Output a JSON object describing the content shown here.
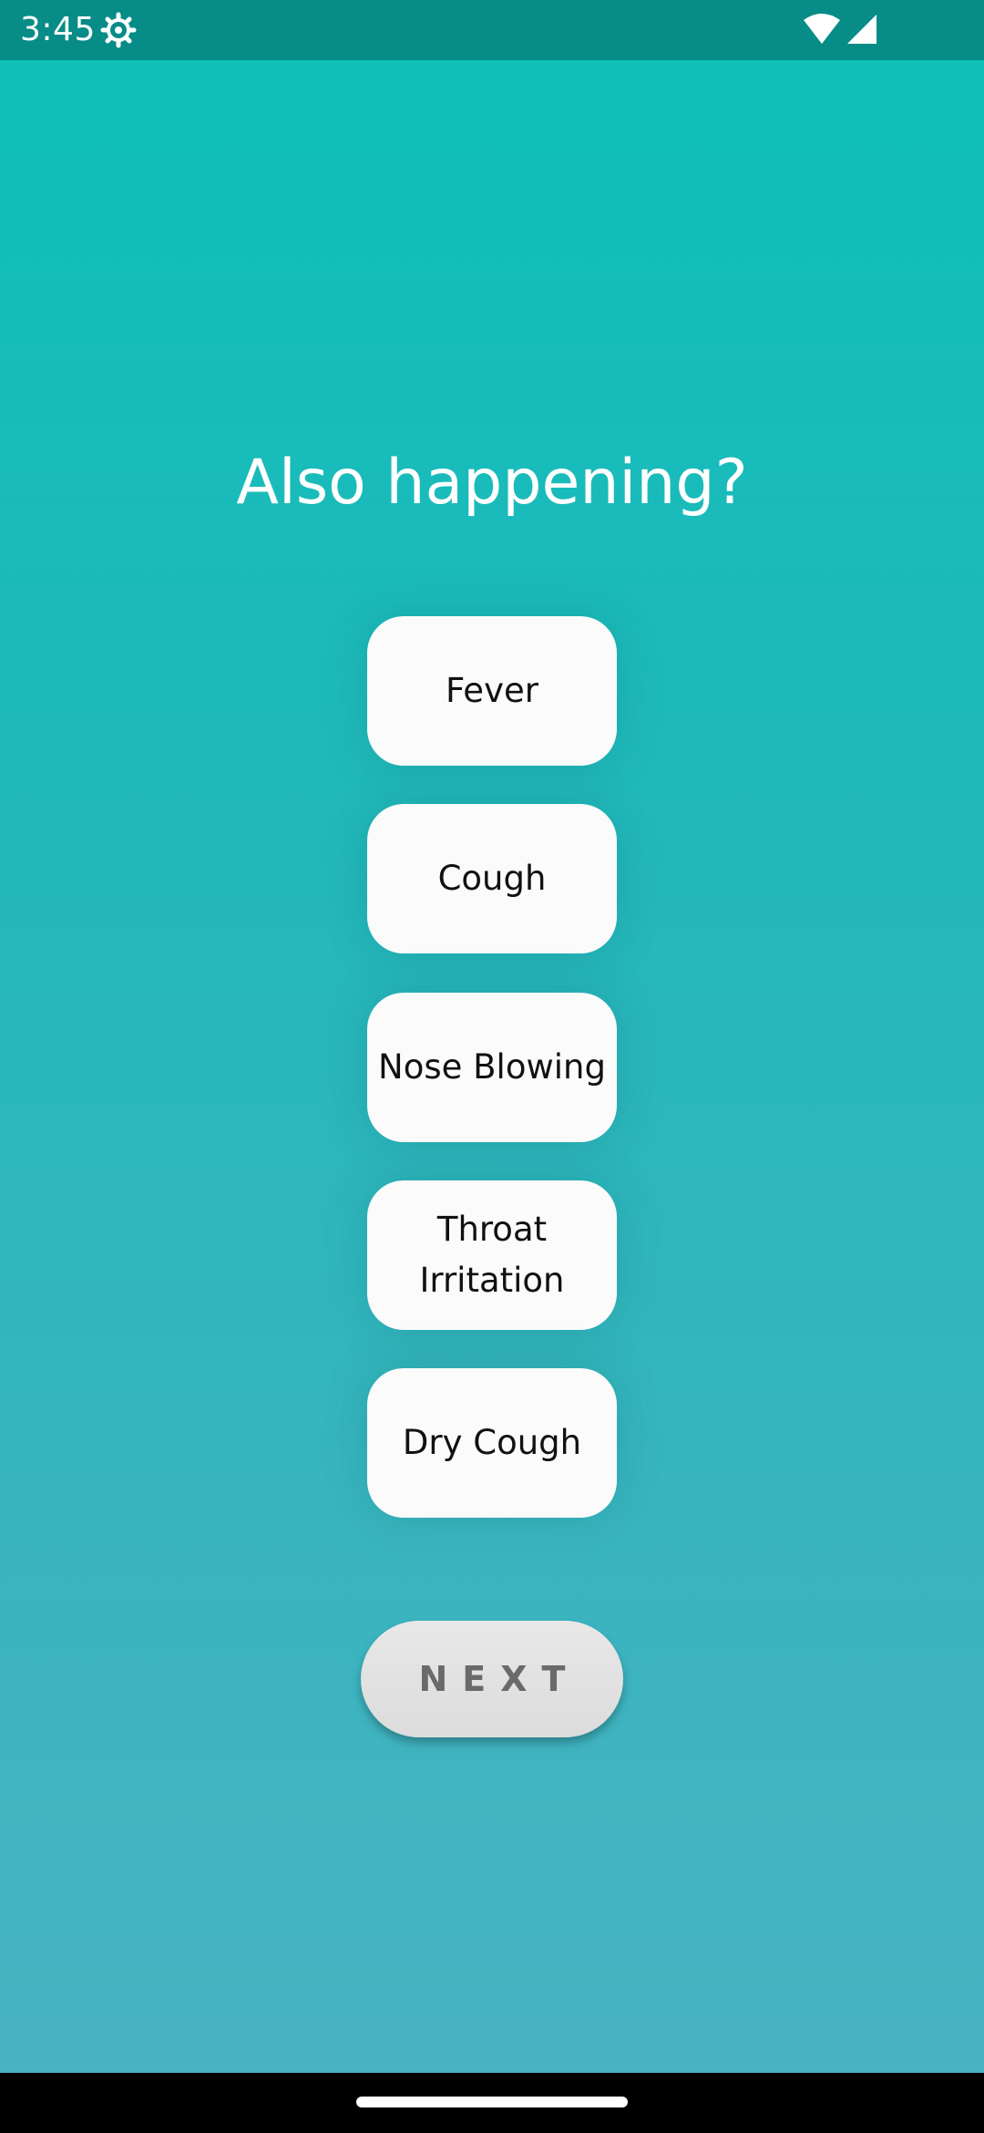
{
  "status_bar": {
    "time": "3:45",
    "icons": [
      "gear-icon",
      "wifi-icon",
      "signal-icon"
    ]
  },
  "screen": {
    "title": "Also happening?",
    "options": [
      {
        "label": "Fever"
      },
      {
        "label": "Cough"
      },
      {
        "label": "Nose Blowing"
      },
      {
        "label_lines": [
          "Throat",
          "Irritation"
        ]
      },
      {
        "label": "Dry Cough"
      }
    ],
    "next_label": "NEXT"
  },
  "colors": {
    "background_top": "#0dc0b8",
    "background_bottom": "#4ab2c2",
    "status_bar": "#078c87",
    "option_background": "#fbfbfb",
    "next_button": "#e0e0e0",
    "next_text": "#6a6a6a"
  }
}
